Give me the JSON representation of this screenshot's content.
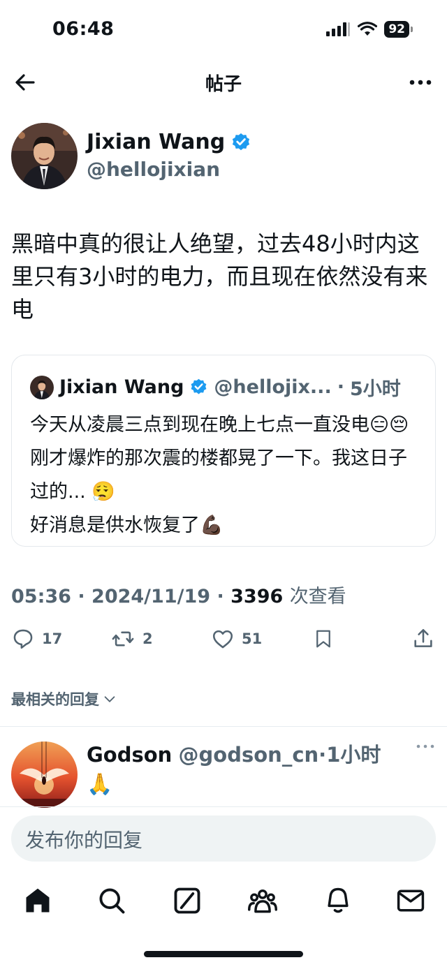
{
  "status_bar": {
    "time": "06:48",
    "battery": "92"
  },
  "nav": {
    "title": "帖子"
  },
  "tweet": {
    "author_name": "Jixian Wang",
    "author_handle": "@hellojixian",
    "text": "黑暗中真的很让人绝望，过去48小时内这里只有3小时的电力，而且现在依然没有来电",
    "time": "05:36",
    "date": "2024/11/19",
    "views": "3396",
    "views_label": "次查看"
  },
  "quote": {
    "author_name": "Jixian Wang",
    "author_handle": "@hellojix...",
    "age": "5小时",
    "text": "今天从凌晨三点到现在晚上七点一直没电😑😔 刚才爆炸的那次震的楼都晃了一下。我这日子过的... 😮‍💨\n好消息是供水恢复了💪🏿"
  },
  "actions": {
    "replies": "17",
    "reposts": "2",
    "likes": "51"
  },
  "sort_label": "最相关的回复",
  "reply": {
    "author_name": "Godson",
    "author_handle": "@godson_cn",
    "age": "1小时",
    "text": "🙏"
  },
  "composer": {
    "placeholder": "发布你的回复"
  },
  "colors": {
    "accent": "#1d9bf0",
    "text": "#0f1419",
    "secondary": "#536471"
  },
  "icons": [
    "back-arrow-icon",
    "more-icon",
    "verified-badge-icon",
    "reply-icon",
    "repost-icon",
    "like-icon",
    "bookmark-icon",
    "share-icon",
    "chevron-down-icon",
    "home-icon",
    "search-icon",
    "grok-icon",
    "communities-icon",
    "notifications-icon",
    "messages-icon"
  ]
}
